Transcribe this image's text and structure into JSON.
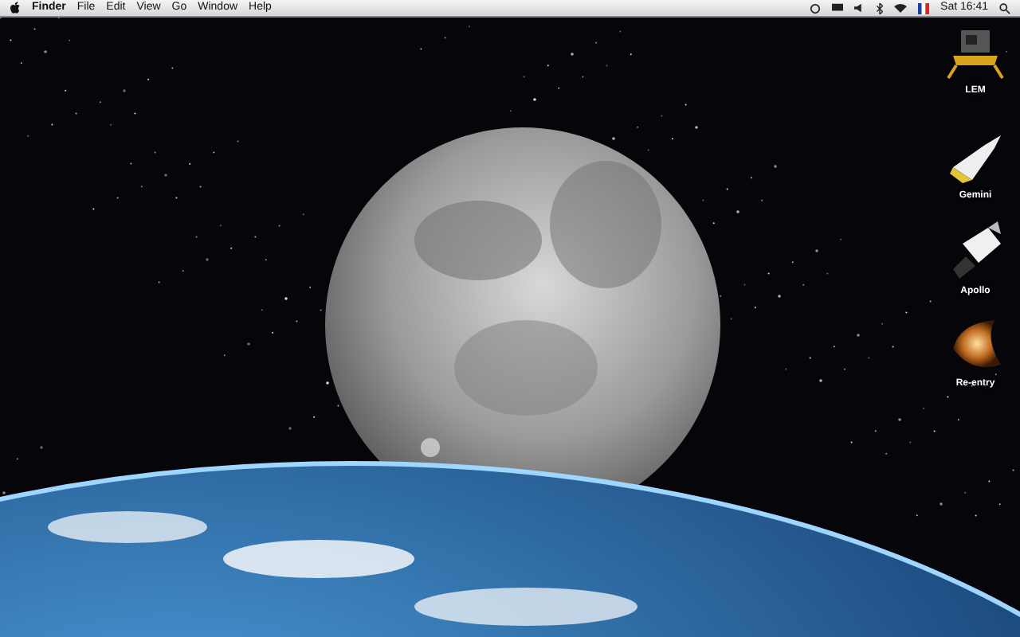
{
  "menu_bar": {
    "app_name": "Finder",
    "menus": [
      "File",
      "Edit",
      "View",
      "Go",
      "Window",
      "Help"
    ],
    "clock": "Sat 16:41"
  },
  "desktop_icons": [
    {
      "label": "LEM"
    },
    {
      "label": "Gemini"
    },
    {
      "label": "Apollo"
    },
    {
      "label": "Re-entry"
    }
  ]
}
